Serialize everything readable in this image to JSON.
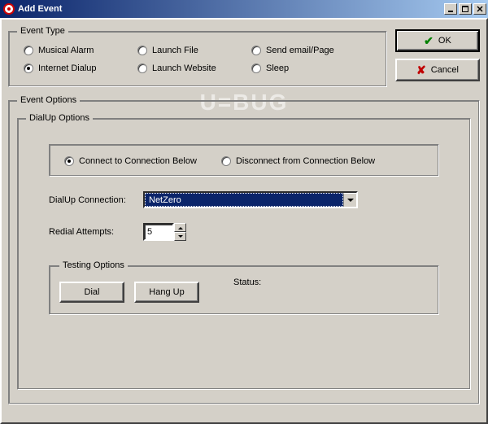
{
  "window": {
    "title": "Add Event"
  },
  "buttons": {
    "ok": "OK",
    "cancel": "Cancel"
  },
  "event_type": {
    "legend": "Event Type",
    "options": {
      "musical_alarm": "Musical Alarm",
      "launch_file": "Launch File",
      "send_email": "Send email/Page",
      "internet_dialup": "Internet Dialup",
      "launch_website": "Launch Website",
      "sleep": "Sleep"
    },
    "selected": "internet_dialup"
  },
  "event_options": {
    "legend": "Event Options"
  },
  "dialup": {
    "legend": "DialUp Options",
    "mode": {
      "connect": "Connect to Connection Below",
      "disconnect": "Disconnect from Connection Below",
      "selected": "connect"
    },
    "connection_label": "DialUp Connection:",
    "connection_value": "NetZero",
    "redial_label": "Redial Attempts:",
    "redial_value": "5"
  },
  "testing": {
    "legend": "Testing Options",
    "dial": "Dial",
    "hangup": "Hang Up",
    "status_label": "Status:",
    "status_value": ""
  },
  "watermark": "U=BUG"
}
